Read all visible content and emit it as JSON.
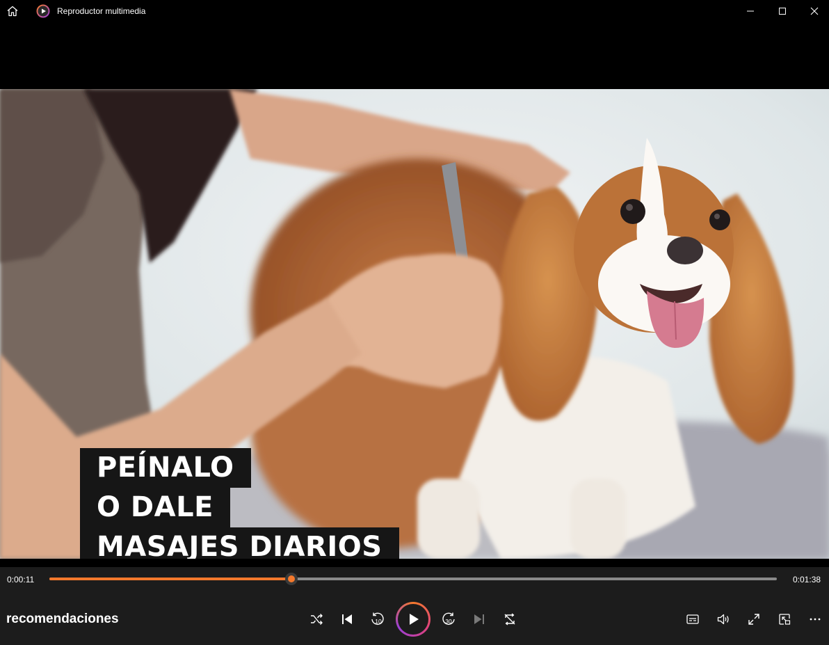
{
  "window": {
    "title": "Reproductor multimedia",
    "icons": {
      "home": "home-icon",
      "app": "media-player-icon",
      "minimize": "minimize-icon",
      "maximize": "maximize-icon",
      "close": "close-icon"
    }
  },
  "video": {
    "caption_lines": [
      "PEÍNALO",
      "O DALE",
      "MASAJES DIARIOS"
    ]
  },
  "playback": {
    "current_time": "0:00:11",
    "total_time": "0:01:38",
    "progress_fraction": 0.333,
    "accent_color": "#f4792c",
    "media_title": "recomendaciones",
    "skip_back_label": "10",
    "skip_forward_label": "30"
  },
  "controls": {
    "center": [
      "shuffle-icon",
      "previous-icon",
      "skip-back-10-icon",
      "play-icon",
      "skip-forward-30-icon",
      "next-icon",
      "repeat-off-icon"
    ],
    "right": [
      "subtitles-icon",
      "volume-icon",
      "fullscreen-icon",
      "mini-player-icon",
      "more-options-icon"
    ]
  }
}
